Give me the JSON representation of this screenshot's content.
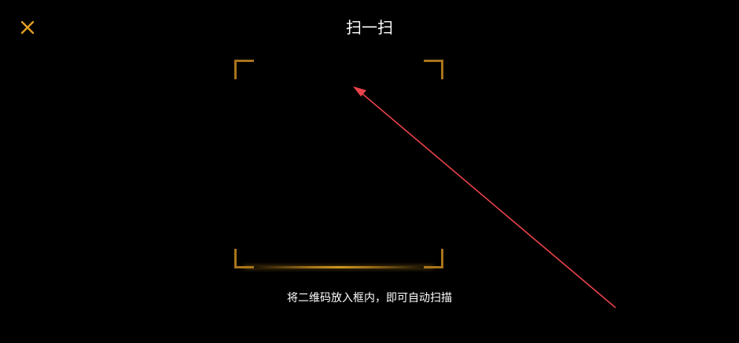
{
  "header": {
    "title": "扫一扫",
    "close_icon": "close-icon"
  },
  "scanner": {
    "hint": "将二维码放入框内，即可自动扫描"
  },
  "colors": {
    "background": "#000000",
    "accent": "#e0a020",
    "frame": "#a8741a",
    "annotation": "#e8424a",
    "text": "#ffffff"
  }
}
